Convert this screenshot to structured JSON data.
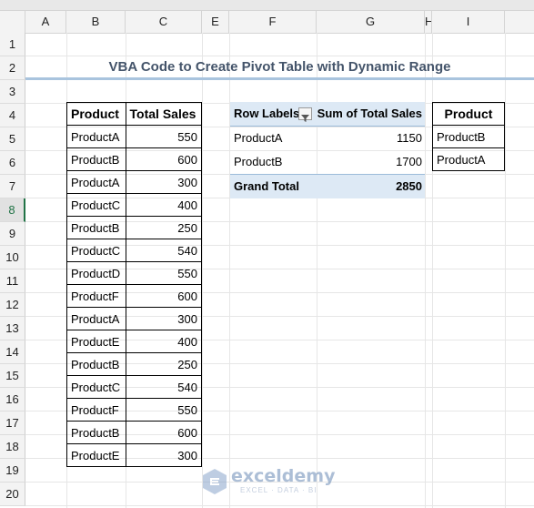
{
  "columns": [
    "A",
    "B",
    "C",
    "E",
    "F",
    "G",
    "H",
    "I"
  ],
  "rows": [
    "1",
    "2",
    "3",
    "4",
    "5",
    "6",
    "7",
    "8",
    "9",
    "10",
    "11",
    "12",
    "13",
    "14",
    "15",
    "16",
    "17",
    "18",
    "19",
    "20"
  ],
  "selected_row": "8",
  "title": "VBA Code to Create Pivot Table with Dynamic Range",
  "source_table": {
    "headers": [
      "Product",
      "Total Sales"
    ],
    "rows": [
      [
        "ProductA",
        "550"
      ],
      [
        "ProductB",
        "600"
      ],
      [
        "ProductA",
        "300"
      ],
      [
        "ProductC",
        "400"
      ],
      [
        "ProductB",
        "250"
      ],
      [
        "ProductC",
        "540"
      ],
      [
        "ProductD",
        "550"
      ],
      [
        "ProductF",
        "600"
      ],
      [
        "ProductA",
        "300"
      ],
      [
        "ProductE",
        "400"
      ],
      [
        "ProductB",
        "250"
      ],
      [
        "ProductC",
        "540"
      ],
      [
        "ProductF",
        "550"
      ],
      [
        "ProductB",
        "600"
      ],
      [
        "ProductE",
        "300"
      ]
    ]
  },
  "pivot": {
    "row_labels": "Row Labels",
    "sum_label": "Sum of Total Sales",
    "rows": [
      {
        "label": "ProductA",
        "value": "1150"
      },
      {
        "label": "ProductB",
        "value": "1700"
      }
    ],
    "grand_total_label": "Grand Total",
    "grand_total_value": "2850"
  },
  "filter_table": {
    "header": "Product",
    "items": [
      "ProductB",
      "ProductA"
    ]
  },
  "watermark": {
    "name": "exceldemy",
    "tagline": "EXCEL · DATA · BI"
  },
  "colors": {
    "accent_green": "#217346",
    "pivot_header": "#dde9f5",
    "title_text": "#44546a"
  }
}
